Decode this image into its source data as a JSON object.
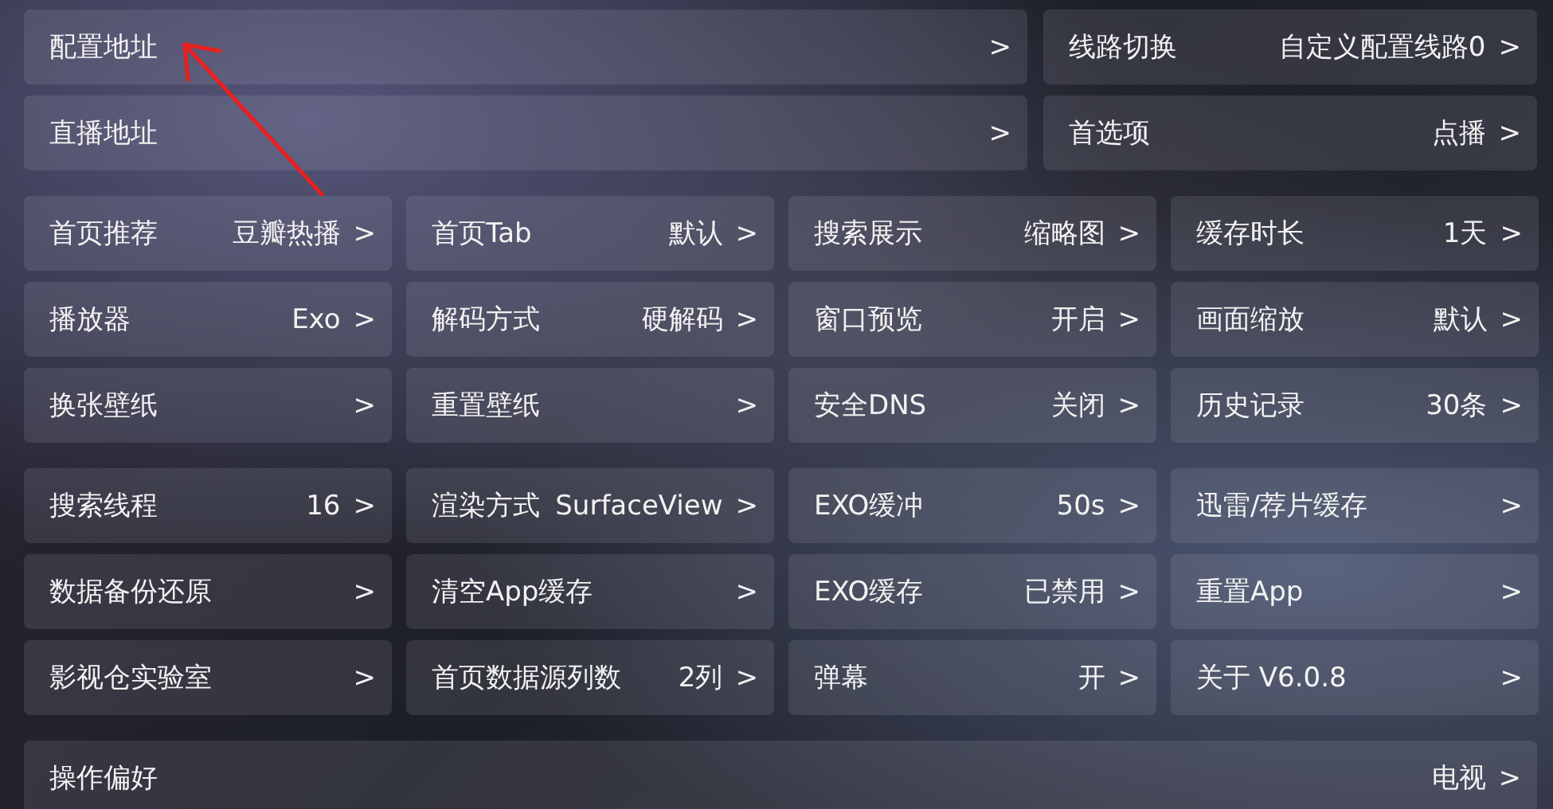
{
  "sections": [
    {
      "kind": "wide",
      "rows": [
        [
          {
            "label": "配置地址",
            "chevron": ">"
          },
          {
            "label": "线路切换",
            "value": "自定义配置线路0",
            "chevron": ">"
          }
        ],
        [
          {
            "label": "直播地址",
            "chevron": ">"
          },
          {
            "label": "首选项",
            "value": "点播",
            "chevron": ">"
          }
        ]
      ]
    },
    {
      "kind": "grid",
      "rows": [
        [
          {
            "label": "首页推荐",
            "value": "豆瓣热播",
            "chevron": ">"
          },
          {
            "label": "首页Tab",
            "value": "默认",
            "chevron": ">"
          },
          {
            "label": "搜索展示",
            "value": "缩略图",
            "chevron": ">"
          },
          {
            "label": "缓存时长",
            "value": "1天",
            "chevron": ">"
          }
        ],
        [
          {
            "label": "播放器",
            "value": "Exo",
            "chevron": ">"
          },
          {
            "label": "解码方式",
            "value": "硬解码",
            "chevron": ">"
          },
          {
            "label": "窗口预览",
            "value": "开启",
            "chevron": ">"
          },
          {
            "label": "画面缩放",
            "value": "默认",
            "chevron": ">"
          }
        ],
        [
          {
            "label": "换张壁纸",
            "chevron": ">"
          },
          {
            "label": "重置壁纸",
            "chevron": ">"
          },
          {
            "label": "安全DNS",
            "value": "关闭",
            "chevron": ">"
          },
          {
            "label": "历史记录",
            "value": "30条",
            "chevron": ">"
          }
        ]
      ]
    },
    {
      "kind": "grid",
      "rows": [
        [
          {
            "label": "搜索线程",
            "value": "16",
            "chevron": ">"
          },
          {
            "label": "渲染方式",
            "value": "SurfaceView",
            "chevron": ">"
          },
          {
            "label": "EXO缓冲",
            "value": "50s",
            "chevron": ">"
          },
          {
            "label": "迅雷/荐片缓存",
            "chevron": ">"
          }
        ],
        [
          {
            "label": "数据备份还原",
            "chevron": ">"
          },
          {
            "label": "清空App缓存",
            "chevron": ">"
          },
          {
            "label": "EXO缓存",
            "value": "已禁用",
            "chevron": ">"
          },
          {
            "label": "重置App",
            "chevron": ">"
          }
        ],
        [
          {
            "label": "影视仓实验室",
            "chevron": ">"
          },
          {
            "label": "首页数据源列数",
            "value": "2列",
            "chevron": ">"
          },
          {
            "label": "弹幕",
            "value": "开",
            "chevron": ">"
          },
          {
            "label": "关于  V6.0.8",
            "chevron": ">"
          }
        ]
      ]
    },
    {
      "kind": "full",
      "rows": [
        [
          {
            "label": "操作偏好",
            "value": "电视",
            "chevron": ">"
          }
        ]
      ]
    }
  ]
}
